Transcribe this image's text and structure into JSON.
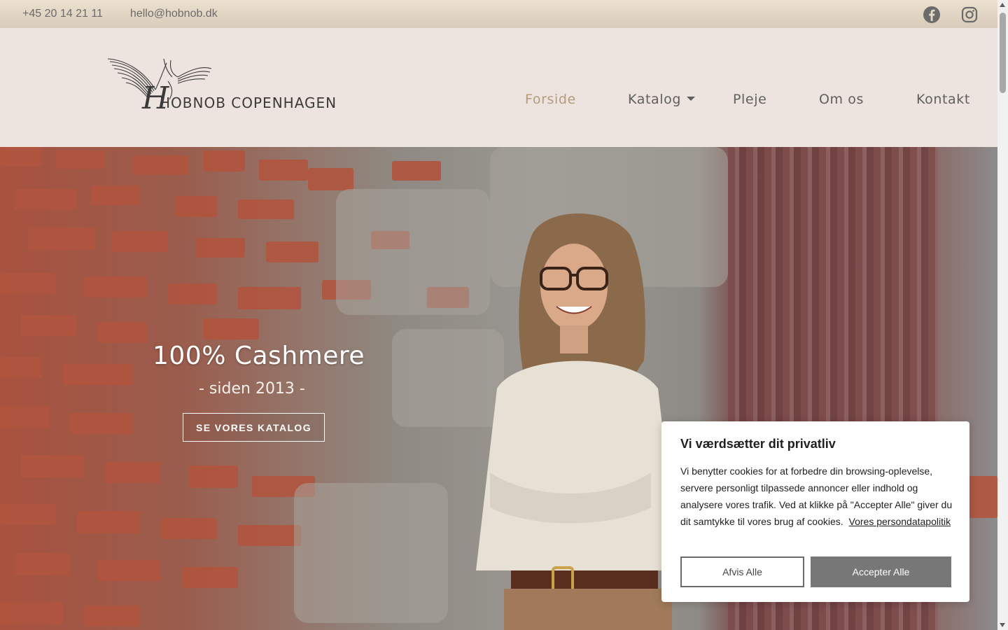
{
  "topbar": {
    "phone": "+45 20 14 21 11",
    "email": "hello@hobnob.dk",
    "socials": [
      {
        "icon": "facebook-icon"
      },
      {
        "icon": "instagram-icon"
      }
    ]
  },
  "header": {
    "logo_text": "HOBNOB COPENHAGEN",
    "nav": [
      {
        "label": "Forside",
        "active": true
      },
      {
        "label": "Katalog",
        "has_dropdown": true
      },
      {
        "label": "Pleje"
      },
      {
        "label": "Om os"
      },
      {
        "label": "Kontakt"
      }
    ]
  },
  "hero": {
    "title": "100% Cashmere",
    "subtitle": "- siden 2013 -",
    "button_label": "SE VORES KATALOG"
  },
  "cookie": {
    "title": "Vi værdsætter dit privatliv",
    "text": "Vi benytter cookies for at forbedre din browsing-oplevelse, servere personligt tilpassede annoncer eller indhold og analysere vores trafik. Ved at klikke på \"Accepter Alle\" giver du dit samtykke til vores brug af cookies.",
    "policy_link": "Vores persondatapolitik",
    "reject_label": "Afvis Alle",
    "accept_label": "Accepter Alle"
  },
  "colors": {
    "topbar_bg": "#e2d6c4",
    "header_bg": "#ede4e0",
    "nav_active": "#b39b7c",
    "nav_default": "#5f5f5f",
    "accept_button": "#777777"
  }
}
